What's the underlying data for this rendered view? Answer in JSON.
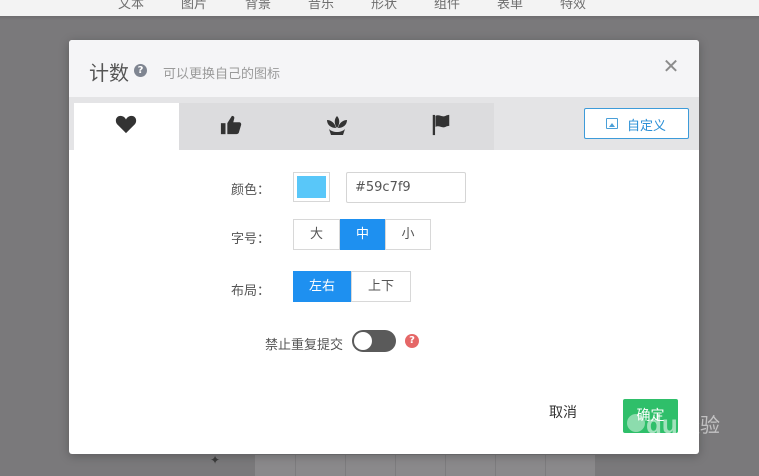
{
  "topnav": {
    "items": [
      "文本",
      "图片",
      "背景",
      "音乐",
      "形状",
      "组件",
      "表单",
      "特效"
    ]
  },
  "modal": {
    "title": "计数",
    "subtitle": "可以更换自己的图标",
    "close_icon": "close-icon",
    "help_icon": "question-circle-icon"
  },
  "tabs": {
    "items": [
      {
        "icon": "heart-icon",
        "active": true
      },
      {
        "icon": "thumbs-up-icon",
        "active": false
      },
      {
        "icon": "lotus-icon",
        "active": false
      },
      {
        "icon": "flag-icon",
        "active": false
      }
    ],
    "custom_label": "自定义",
    "custom_icon": "image-icon"
  },
  "form": {
    "color_label": "颜色：",
    "color_value": "#59c7f9",
    "size_label": "字号：",
    "size_options": [
      "大",
      "中",
      "小"
    ],
    "size_selected": "中",
    "layout_label": "布局：",
    "layout_options": [
      "左右",
      "上下"
    ],
    "layout_selected": "左右",
    "no_repeat_label": "禁止重复提交",
    "no_repeat_enabled": false,
    "no_repeat_help_icon": "question-circle-icon"
  },
  "footer": {
    "cancel_label": "取消",
    "ok_label": "确定"
  },
  "colors": {
    "accent_blue": "#1e90f0",
    "ok_green": "#2fbf6a",
    "swatch": "#59c7f9",
    "warning_red": "#e56767"
  },
  "watermark": {
    "text": "Baidu经验"
  }
}
